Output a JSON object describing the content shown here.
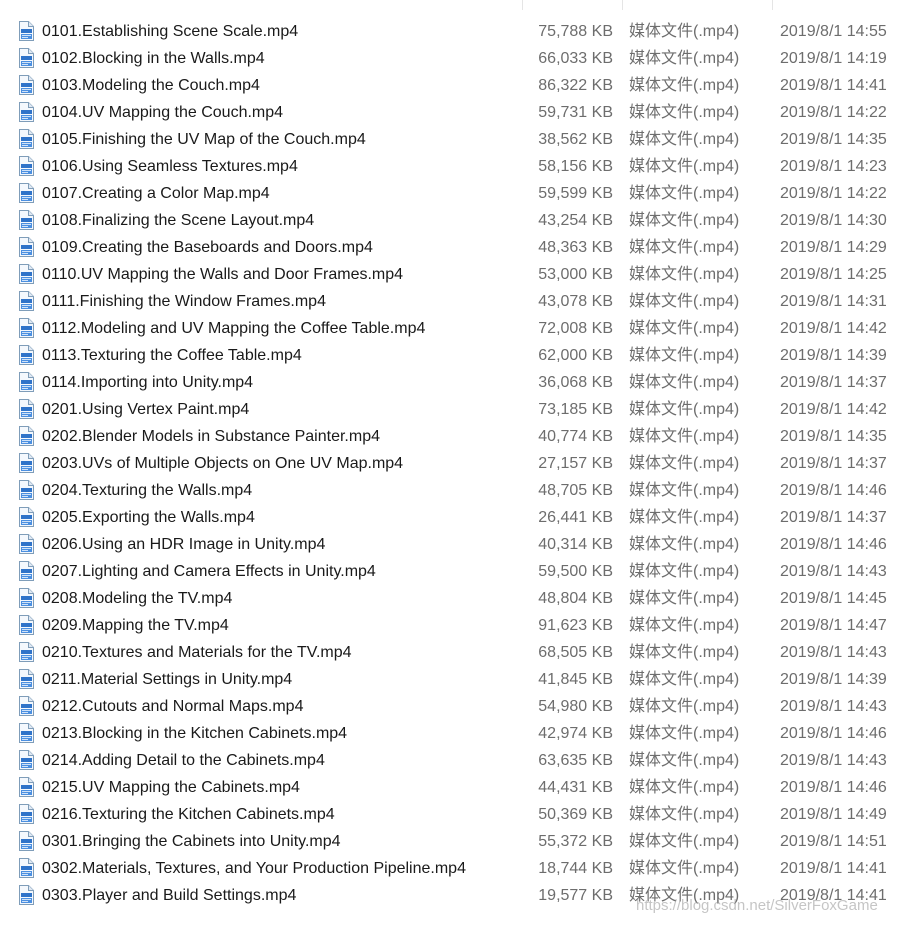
{
  "files": [
    {
      "name": "0101.Establishing Scene Scale.mp4",
      "size": "75,788 KB",
      "type": "媒体文件(.mp4)",
      "date": "2019/8/1 14:55"
    },
    {
      "name": "0102.Blocking in the Walls.mp4",
      "size": "66,033 KB",
      "type": "媒体文件(.mp4)",
      "date": "2019/8/1 14:19"
    },
    {
      "name": "0103.Modeling the Couch.mp4",
      "size": "86,322 KB",
      "type": "媒体文件(.mp4)",
      "date": "2019/8/1 14:41"
    },
    {
      "name": "0104.UV Mapping the Couch.mp4",
      "size": "59,731 KB",
      "type": "媒体文件(.mp4)",
      "date": "2019/8/1 14:22"
    },
    {
      "name": "0105.Finishing the UV Map of the Couch.mp4",
      "size": "38,562 KB",
      "type": "媒体文件(.mp4)",
      "date": "2019/8/1 14:35"
    },
    {
      "name": "0106.Using Seamless Textures.mp4",
      "size": "58,156 KB",
      "type": "媒体文件(.mp4)",
      "date": "2019/8/1 14:23"
    },
    {
      "name": "0107.Creating a Color Map.mp4",
      "size": "59,599 KB",
      "type": "媒体文件(.mp4)",
      "date": "2019/8/1 14:22"
    },
    {
      "name": "0108.Finalizing the Scene Layout.mp4",
      "size": "43,254 KB",
      "type": "媒体文件(.mp4)",
      "date": "2019/8/1 14:30"
    },
    {
      "name": "0109.Creating the Baseboards and Doors.mp4",
      "size": "48,363 KB",
      "type": "媒体文件(.mp4)",
      "date": "2019/8/1 14:29"
    },
    {
      "name": "0110.UV Mapping the Walls and Door Frames.mp4",
      "size": "53,000 KB",
      "type": "媒体文件(.mp4)",
      "date": "2019/8/1 14:25"
    },
    {
      "name": "0111.Finishing the Window Frames.mp4",
      "size": "43,078 KB",
      "type": "媒体文件(.mp4)",
      "date": "2019/8/1 14:31"
    },
    {
      "name": "0112.Modeling and UV Mapping the Coffee Table.mp4",
      "size": "72,008 KB",
      "type": "媒体文件(.mp4)",
      "date": "2019/8/1 14:42"
    },
    {
      "name": "0113.Texturing the Coffee Table.mp4",
      "size": "62,000 KB",
      "type": "媒体文件(.mp4)",
      "date": "2019/8/1 14:39"
    },
    {
      "name": "0114.Importing into Unity.mp4",
      "size": "36,068 KB",
      "type": "媒体文件(.mp4)",
      "date": "2019/8/1 14:37"
    },
    {
      "name": "0201.Using Vertex Paint.mp4",
      "size": "73,185 KB",
      "type": "媒体文件(.mp4)",
      "date": "2019/8/1 14:42"
    },
    {
      "name": "0202.Blender Models in Substance Painter.mp4",
      "size": "40,774 KB",
      "type": "媒体文件(.mp4)",
      "date": "2019/8/1 14:35"
    },
    {
      "name": "0203.UVs of Multiple Objects on One UV Map.mp4",
      "size": "27,157 KB",
      "type": "媒体文件(.mp4)",
      "date": "2019/8/1 14:37"
    },
    {
      "name": "0204.Texturing the Walls.mp4",
      "size": "48,705 KB",
      "type": "媒体文件(.mp4)",
      "date": "2019/8/1 14:46"
    },
    {
      "name": "0205.Exporting the Walls.mp4",
      "size": "26,441 KB",
      "type": "媒体文件(.mp4)",
      "date": "2019/8/1 14:37"
    },
    {
      "name": "0206.Using an HDR Image in Unity.mp4",
      "size": "40,314 KB",
      "type": "媒体文件(.mp4)",
      "date": "2019/8/1 14:46"
    },
    {
      "name": "0207.Lighting and Camera Effects in Unity.mp4",
      "size": "59,500 KB",
      "type": "媒体文件(.mp4)",
      "date": "2019/8/1 14:43"
    },
    {
      "name": "0208.Modeling the TV.mp4",
      "size": "48,804 KB",
      "type": "媒体文件(.mp4)",
      "date": "2019/8/1 14:45"
    },
    {
      "name": "0209.Mapping the TV.mp4",
      "size": "91,623 KB",
      "type": "媒体文件(.mp4)",
      "date": "2019/8/1 14:47"
    },
    {
      "name": "0210.Textures and Materials for the TV.mp4",
      "size": "68,505 KB",
      "type": "媒体文件(.mp4)",
      "date": "2019/8/1 14:43"
    },
    {
      "name": "0211.Material Settings in Unity.mp4",
      "size": "41,845 KB",
      "type": "媒体文件(.mp4)",
      "date": "2019/8/1 14:39"
    },
    {
      "name": "0212.Cutouts and Normal Maps.mp4",
      "size": "54,980 KB",
      "type": "媒体文件(.mp4)",
      "date": "2019/8/1 14:43"
    },
    {
      "name": "0213.Blocking in the Kitchen Cabinets.mp4",
      "size": "42,974 KB",
      "type": "媒体文件(.mp4)",
      "date": "2019/8/1 14:46"
    },
    {
      "name": "0214.Adding Detail to the Cabinets.mp4",
      "size": "63,635 KB",
      "type": "媒体文件(.mp4)",
      "date": "2019/8/1 14:43"
    },
    {
      "name": "0215.UV Mapping the Cabinets.mp4",
      "size": "44,431 KB",
      "type": "媒体文件(.mp4)",
      "date": "2019/8/1 14:46"
    },
    {
      "name": "0216.Texturing the Kitchen Cabinets.mp4",
      "size": "50,369 KB",
      "type": "媒体文件(.mp4)",
      "date": "2019/8/1 14:49"
    },
    {
      "name": "0301.Bringing the Cabinets into Unity.mp4",
      "size": "55,372 KB",
      "type": "媒体文件(.mp4)",
      "date": "2019/8/1 14:51"
    },
    {
      "name": "0302.Materials, Textures, and Your Production Pipeline.mp4",
      "size": "18,744 KB",
      "type": "媒体文件(.mp4)",
      "date": "2019/8/1 14:41"
    },
    {
      "name": "0303.Player and Build Settings.mp4",
      "size": "19,577 KB",
      "type": "媒体文件(.mp4)",
      "date": "2019/8/1 14:41"
    }
  ],
  "file_icon": "mp4-file-icon",
  "watermark": "https://blog.csdn.net/SilverFoxGame"
}
